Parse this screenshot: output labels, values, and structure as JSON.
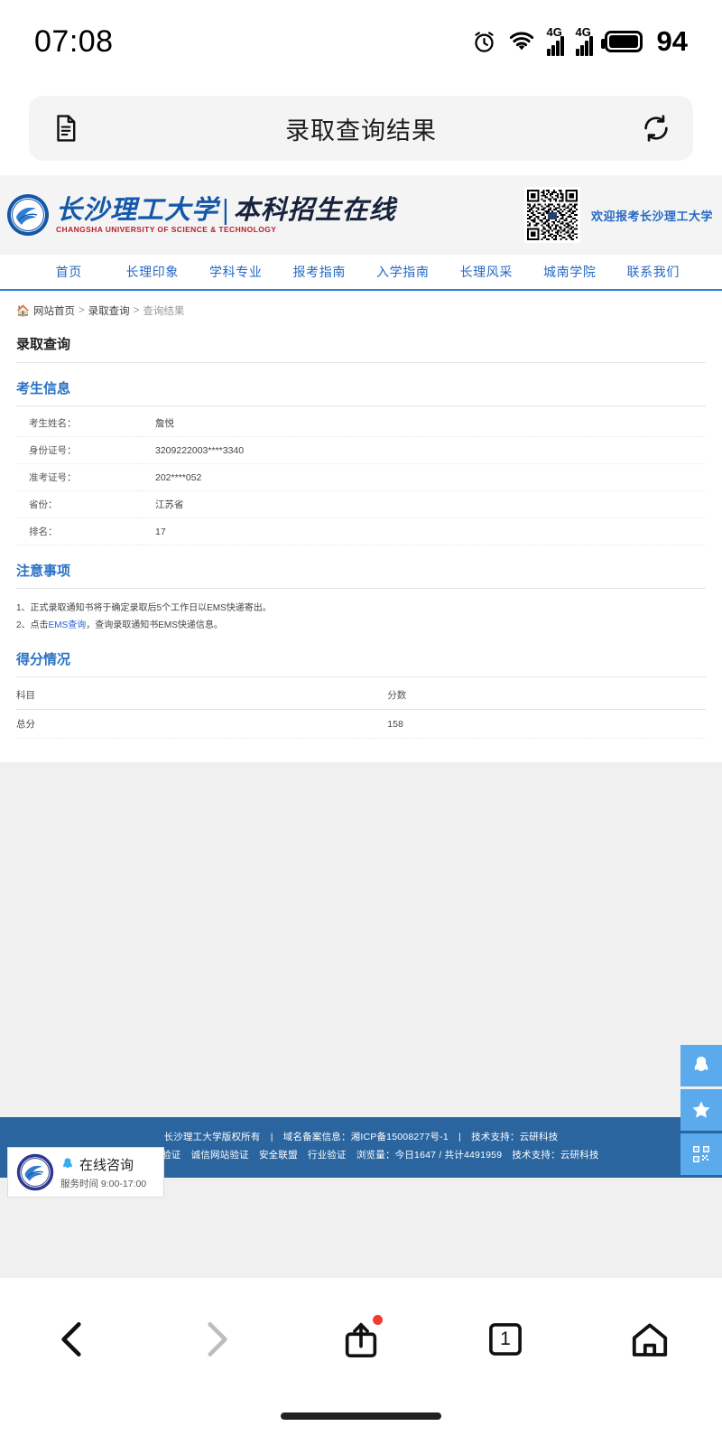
{
  "status_bar": {
    "time": "07:08",
    "battery_level": "94",
    "icons": [
      "alarm-icon",
      "wifi-icon",
      "signal-4g-icon",
      "signal-4g-icon",
      "battery-icon"
    ],
    "network_label": "4G"
  },
  "browser": {
    "title": "录取查询结果",
    "left_icon": "document-icon",
    "right_icon": "refresh-icon"
  },
  "site_header": {
    "brand_cn": "长沙理工大学",
    "brand_divider": "|",
    "brand_sub": "本科招生在线",
    "brand_en": "CHANGSHA UNIVERSITY OF SCIENCE & TECHNOLOGY",
    "qr_alt": "qr-code-icon",
    "welcome": "欢迎报考长沙理工大学",
    "brand_color": "#1557a8",
    "accent_color": "#2668c4"
  },
  "nav": {
    "items": [
      {
        "label": "首页"
      },
      {
        "label": "长理印象"
      },
      {
        "label": "学科专业"
      },
      {
        "label": "报考指南"
      },
      {
        "label": "入学指南"
      },
      {
        "label": "长理风采"
      },
      {
        "label": "城南学院"
      },
      {
        "label": "联系我们"
      }
    ]
  },
  "breadcrumb": {
    "home_icon": "home-icon",
    "items": [
      "网站首页",
      "录取查询",
      "查询结果"
    ],
    "separator": ">"
  },
  "page": {
    "title": "录取查询"
  },
  "candidate": {
    "section_title": "考生信息",
    "rows": [
      {
        "label": "考生姓名：",
        "value": "詹悦"
      },
      {
        "label": "身份证号：",
        "value": "3209222003****3340"
      },
      {
        "label": "准考证号：",
        "value": "202****052"
      },
      {
        "label": "省份：",
        "value": "江苏省"
      },
      {
        "label": "排名：",
        "value": "17"
      }
    ]
  },
  "notice": {
    "section_title": "注意事项",
    "line1": "1、正式录取通知书将于确定录取后5个工作日以EMS快递寄出。",
    "line2_prefix": "2、点击",
    "line2_link": "EMS查询",
    "line2_suffix": "，查询录取通知书EMS快递信息。"
  },
  "score": {
    "section_title": "得分情况",
    "columns": [
      "科目",
      "分数"
    ],
    "rows": [
      {
        "subject": "总分",
        "value": "158"
      }
    ]
  },
  "footer": {
    "line1": {
      "copyright": "长沙理工大学版权所有",
      "sep1": "|",
      "icp": "域名备案信息：湘ICP备15008277号-1",
      "sep2": "|",
      "support": "技术支持：云研科技"
    },
    "line2": {
      "item1": "可信网站验证",
      "item2": "诚信网站验证",
      "item3": "安全联盟",
      "item4": "行业验证",
      "visits": "浏览量：今日1647 / 共计4491959",
      "support": "技术支持：云研科技"
    },
    "bg_color": "#2a65a0"
  },
  "side_rail": {
    "items": [
      {
        "icon": "qq-penguin-icon"
      },
      {
        "icon": "star-icon"
      },
      {
        "icon": "qr-code-icon"
      }
    ],
    "bg_color": "#5aaaec"
  },
  "chat_widget": {
    "seal_icon": "university-seal-icon",
    "bubble_icon": "qq-penguin-icon",
    "title": "在线咨询",
    "subtitle": "服务时间 9:00-17:00"
  },
  "bottom_nav": {
    "items": [
      {
        "name": "back",
        "icon": "chevron-left-icon",
        "label": ""
      },
      {
        "name": "forward",
        "icon": "chevron-right-icon",
        "label": ""
      },
      {
        "name": "share",
        "icon": "share-icon",
        "label": "",
        "badge": true
      },
      {
        "name": "tabs",
        "icon": "tabs-icon",
        "label": "1"
      },
      {
        "name": "home",
        "icon": "home-icon",
        "label": ""
      }
    ]
  }
}
